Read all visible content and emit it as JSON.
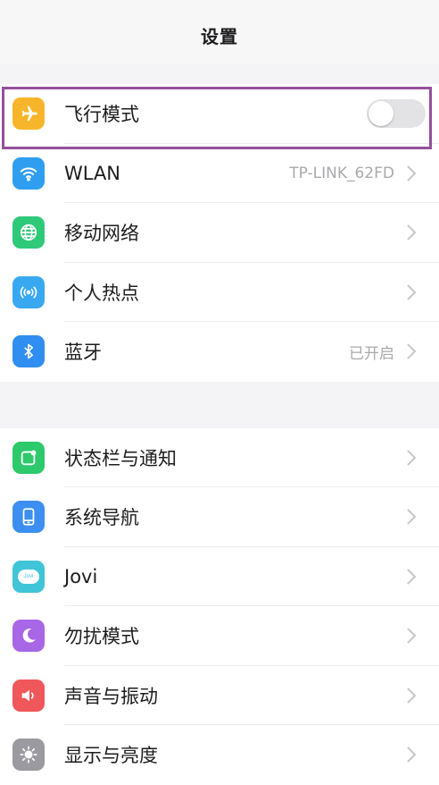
{
  "header": {
    "title": "设置"
  },
  "colors": {
    "highlight": "#94509c",
    "airplane": "#f7b52b",
    "wlan": "#2f9ef0",
    "mobile": "#2fc97a",
    "hotspot": "#38a9f0",
    "bluetooth": "#2f8ef0",
    "statusbar": "#2dc96b",
    "navigation": "#3c8ff0",
    "jovi": "#40c4d8",
    "dnd": "#a867e6",
    "sound": "#f0575a",
    "display": "#9a9aa0"
  },
  "groups": [
    {
      "items": [
        {
          "label": "飞行模式",
          "icon": "airplane-icon",
          "toggle": {
            "on": false
          }
        },
        {
          "label": "WLAN",
          "icon": "wifi-icon",
          "value": "TP-LINK_62FD"
        },
        {
          "label": "移动网络",
          "icon": "globe-icon",
          "value": ""
        },
        {
          "label": "个人热点",
          "icon": "hotspot-icon",
          "value": ""
        },
        {
          "label": "蓝牙",
          "icon": "bluetooth-icon",
          "value": "已开启"
        }
      ]
    },
    {
      "items": [
        {
          "label": "状态栏与通知",
          "icon": "notification-icon"
        },
        {
          "label": "系统导航",
          "icon": "navigation-icon"
        },
        {
          "label": "Jovi",
          "icon": "jovi-icon",
          "icon_text": "Jovi"
        },
        {
          "label": "勿扰模式",
          "icon": "moon-icon"
        },
        {
          "label": "声音与振动",
          "icon": "speaker-icon"
        },
        {
          "label": "显示与亮度",
          "icon": "sun-icon"
        }
      ]
    }
  ]
}
